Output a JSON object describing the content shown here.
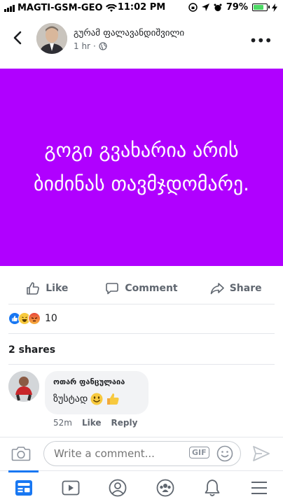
{
  "status_bar": {
    "carrier": "MAGTI-GSM-GEO",
    "time": "11:02 PM",
    "battery": "79%",
    "battery_level": 0.79,
    "battery_color": "#4cd964"
  },
  "post": {
    "author": "გურამ ფალავანდიშვილი",
    "time": "1 hr",
    "separator": "·",
    "privacy_icon": "globe-icon",
    "text": "გოგი გვახარია არის ბიძინას თავმჯდომარე.",
    "background_color": "#b000ff"
  },
  "actions": {
    "like": "Like",
    "comment": "Comment",
    "share": "Share"
  },
  "reactions": {
    "icons": [
      "like-icon",
      "haha-icon",
      "angry-icon"
    ],
    "count": "10"
  },
  "shares": "2 shares",
  "comment": {
    "author": "ოთარ ფანცულაია",
    "text": "ზუსტად",
    "emojis": [
      "smile-emoji",
      "thumbs-up-emoji"
    ],
    "time": "52m",
    "like": "Like",
    "reply": "Reply"
  },
  "composer": {
    "placeholder": "Write a comment...",
    "gif": "GIF"
  },
  "nav": {
    "items": [
      "news-feed-icon",
      "watch-icon",
      "profile-icon",
      "groups-icon",
      "notifications-icon",
      "menu-icon"
    ],
    "active": "news-feed-icon",
    "accent": "#1877f2"
  }
}
